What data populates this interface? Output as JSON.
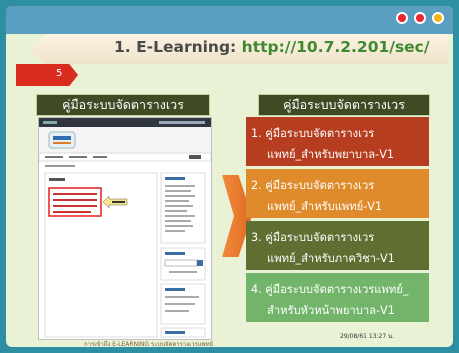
{
  "header": {
    "prefix": "1. E-Learning: ",
    "url": "http://10.7.2.201/sec/"
  },
  "slide_number": "5",
  "left_label": "คู่มือระบบจัดตารางเวร",
  "right_label": "คู่มือระบบจัดตารางเวร",
  "manual_items": [
    {
      "line1": "1. คู่มือระบบจัดตารางเวร",
      "line2": "แพทย์_สำหรับพยาบาล-V1",
      "color": "#b63d1f"
    },
    {
      "line1": "2. คู่มือระบบจัดตารางเวร",
      "line2": "แพทย์_สำหรับแพทย์-V1",
      "color": "#df8b2c"
    },
    {
      "line1": "3. คู่มือระบบจัดตารางเวร",
      "line2": "แพทย์_สำหรับภาควิชา-V1",
      "color": "#5f6e31"
    },
    {
      "line1": "4. คู่มือระบบจัดตารางเวรแพทย์_",
      "line2": "สำหรับหัวหน้าพยาบาล-V1",
      "color": "#72b56a"
    }
  ],
  "footer_text": "การเข้าถึง E-LEARNING ระบบจัดตารางเวรแพทย์",
  "date_text": "29/08/61 13:27 น.",
  "colors": {
    "dot_colors": [
      "#e8262d",
      "#e8262d",
      "#f1b51c"
    ]
  }
}
